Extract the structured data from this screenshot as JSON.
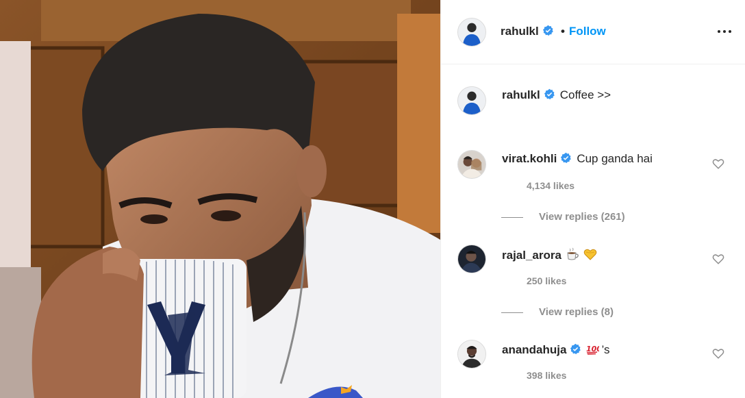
{
  "post": {
    "author": "rahulkl",
    "follow_separator": "•",
    "follow_label": "Follow",
    "more_icon": "more-options-icon",
    "caption_user": "rahulkl",
    "caption_text": "Coffee >>"
  },
  "comments": [
    {
      "user": "virat.kohli",
      "verified": true,
      "text": "Cup ganda hai",
      "emojis": [],
      "likes": "4,134 likes",
      "replies": "View replies (261)"
    },
    {
      "user": "rajal_arora",
      "verified": false,
      "text": "",
      "emojis": [
        "hot-beverage-emoji",
        "yellow-heart-emoji"
      ],
      "likes": "250 likes",
      "replies": "View replies (8)"
    },
    {
      "user": "anandahuja",
      "verified": true,
      "text": "’s",
      "emojis": [
        "hundred-points-emoji"
      ],
      "likes": "398 likes",
      "replies": ""
    }
  ],
  "colors": {
    "accent": "#0095f6",
    "verified": "#3897f0",
    "muted": "#8e8e8e",
    "text": "#262626"
  }
}
